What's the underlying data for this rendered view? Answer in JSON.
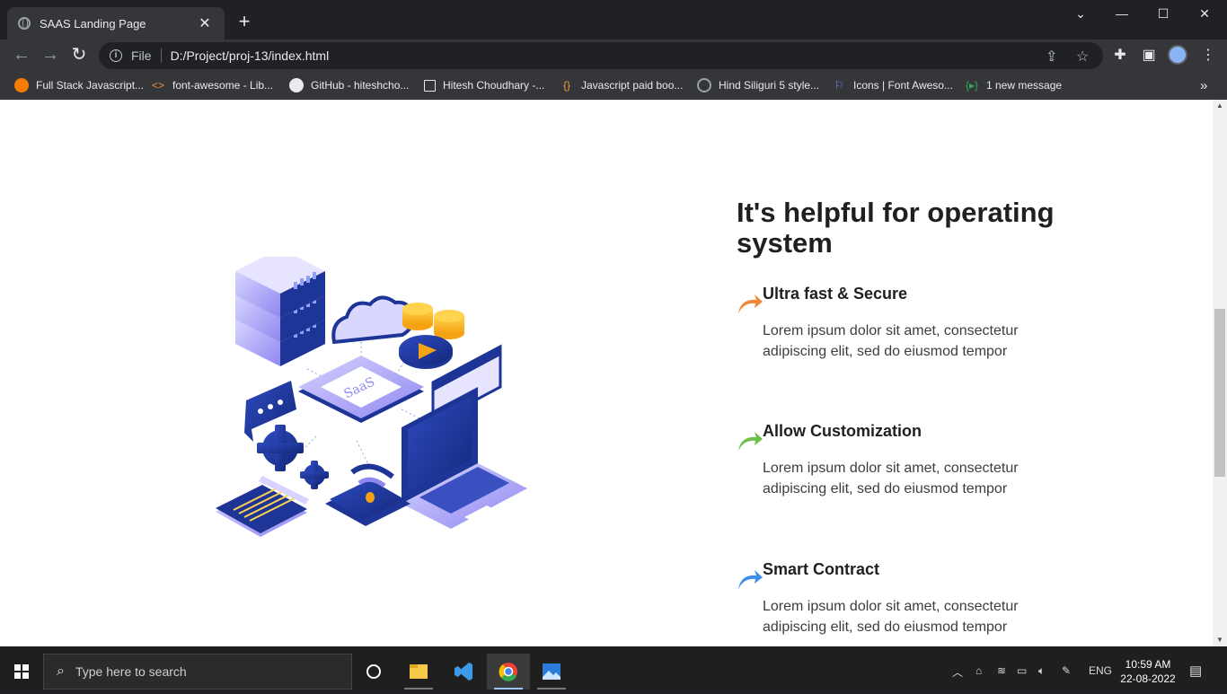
{
  "browser": {
    "tab_title": "SAAS Landing Page",
    "tab_close": "✕",
    "new_tab": "+",
    "url_scheme": "File",
    "url": "D:/Project/proj-13/index.html",
    "bookmarks": [
      {
        "label": "Full Stack Javascript...",
        "icon": "orange-circle-icon"
      },
      {
        "label": "font-awesome - Lib...",
        "icon": "code-brackets-icon"
      },
      {
        "label": "GitHub - hiteshcho...",
        "icon": "github-icon"
      },
      {
        "label": "Hitesh Choudhary -...",
        "icon": "square-icon"
      },
      {
        "label": "Javascript paid boo...",
        "icon": "braces-icon"
      },
      {
        "label": "Hind Siliguri 5 style...",
        "icon": "globe-icon"
      },
      {
        "label": "Icons | Font Aweso...",
        "icon": "flag-icon"
      },
      {
        "label": "1 new message",
        "icon": "message-icon"
      }
    ],
    "more_bookmarks": "»"
  },
  "page": {
    "heading": "It's helpful for operating system",
    "features": [
      {
        "title": "Ultra fast & Secure",
        "text": "Lorem ipsum dolor sit amet, consectetur adipiscing elit, sed do eiusmod tempor",
        "arrow_color": "#f0873a"
      },
      {
        "title": "Allow Customization",
        "text": "Lorem ipsum dolor sit amet, consectetur adipiscing elit, sed do eiusmod tempor",
        "arrow_color": "#6cc04a"
      },
      {
        "title": "Smart Contract",
        "text": "Lorem ipsum dolor sit amet, consectetur adipiscing elit, sed do eiusmod tempor",
        "arrow_color": "#3b8fe8"
      }
    ],
    "illustration_label": "SaaS"
  },
  "taskbar": {
    "search_placeholder": "Type here to search",
    "language": "ENG",
    "time": "10:59 AM",
    "date": "22-08-2022"
  }
}
